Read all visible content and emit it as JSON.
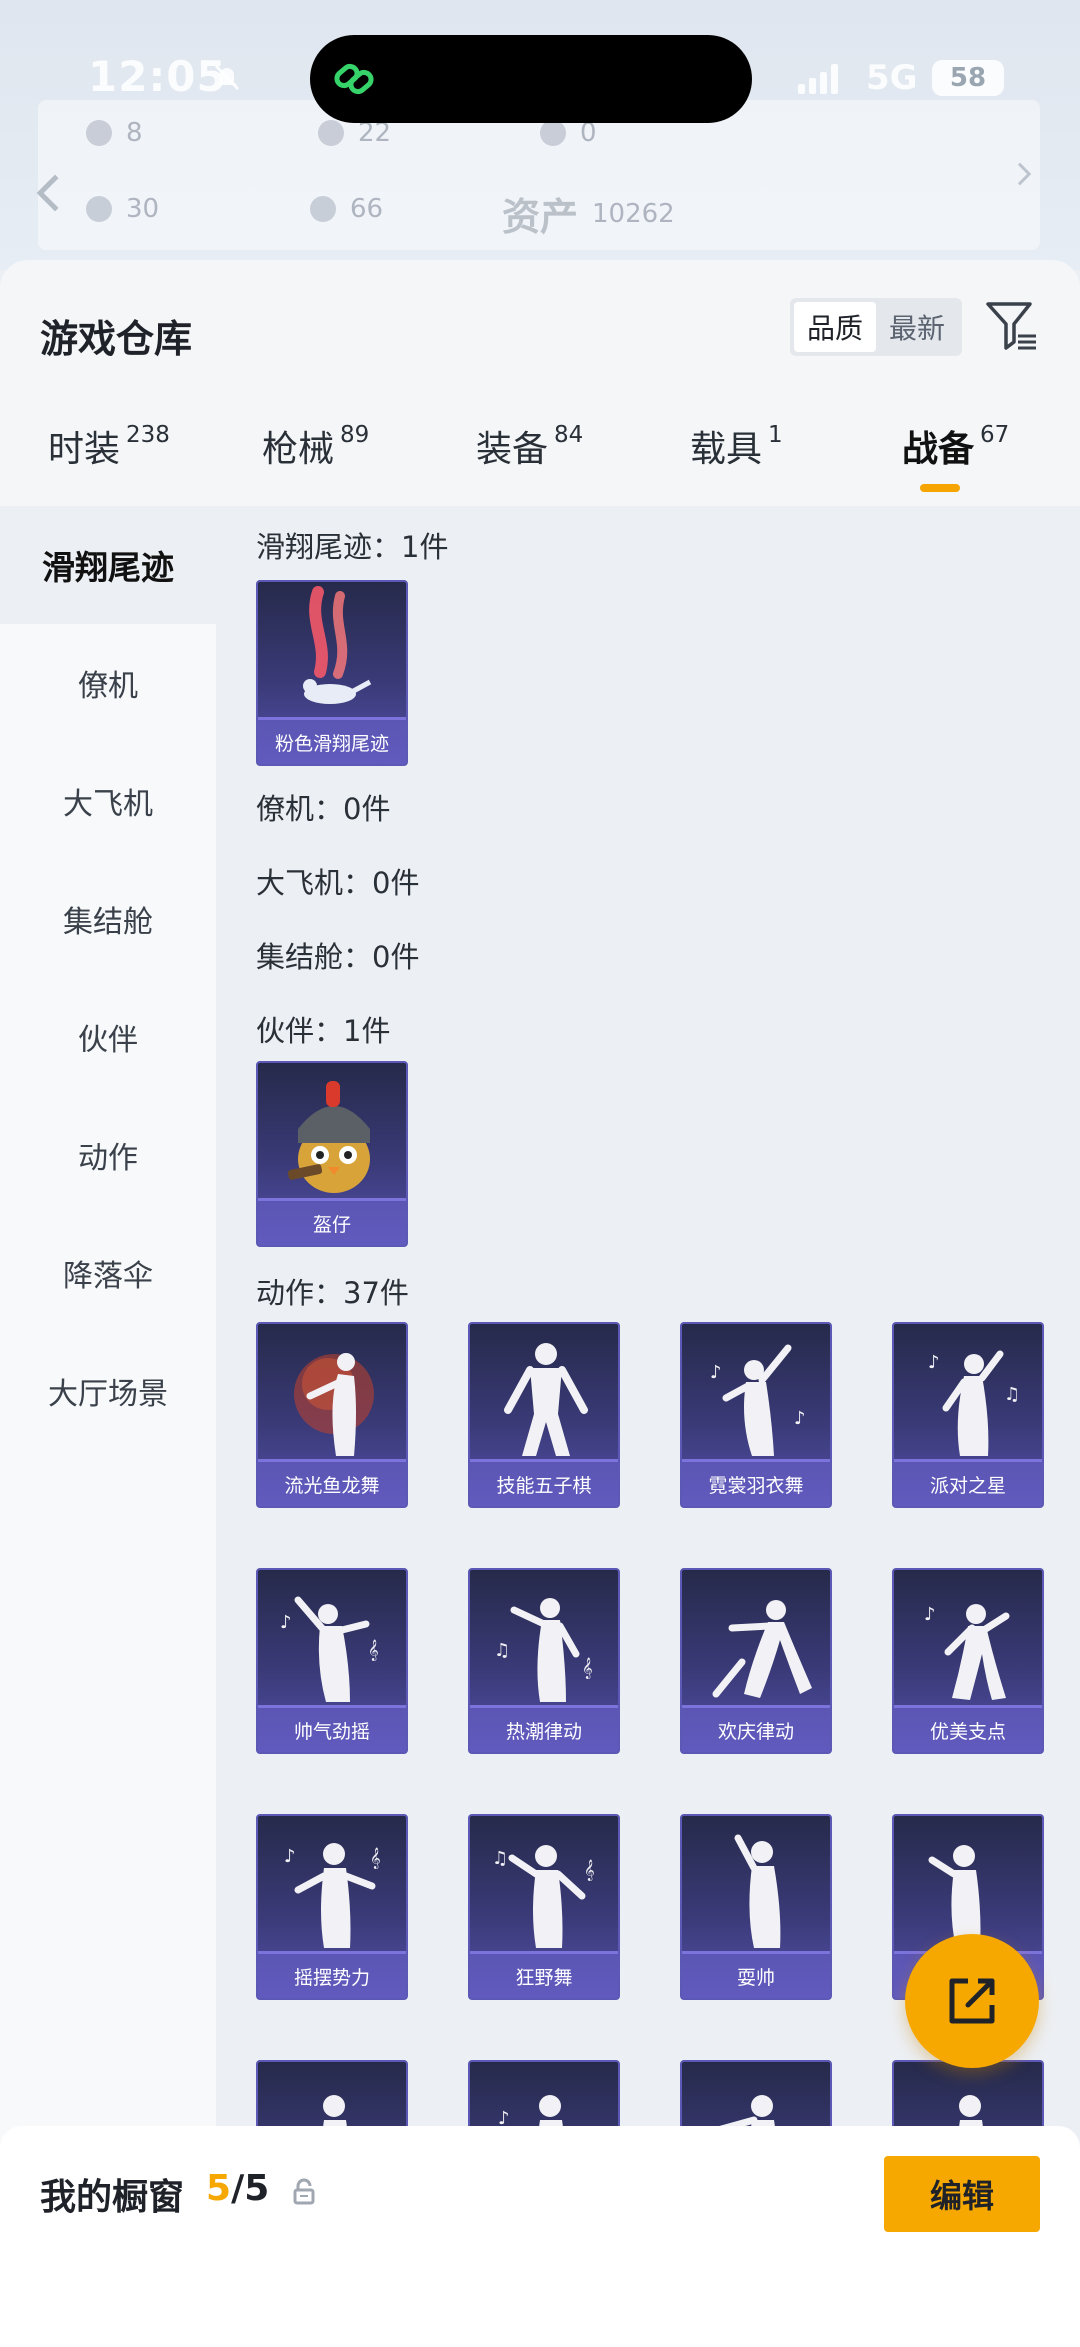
{
  "status_bar": {
    "time": "12:05",
    "network": "5G",
    "battery": "58"
  },
  "background": {
    "stats": [
      "8",
      "22",
      "0",
      "30",
      "66"
    ],
    "asset_label": "资产",
    "asset_value": "10262"
  },
  "sheet": {
    "title": "游戏仓库",
    "sort_options": [
      {
        "label": "品质",
        "active": true
      },
      {
        "label": "最新",
        "active": false
      }
    ]
  },
  "tabs": [
    {
      "label": "时装",
      "count": "238",
      "active": false
    },
    {
      "label": "枪械",
      "count": "89",
      "active": false
    },
    {
      "label": "装备",
      "count": "84",
      "active": false
    },
    {
      "label": "载具",
      "count": "1",
      "active": false
    },
    {
      "label": "战备",
      "count": "67",
      "active": true
    }
  ],
  "sidenav": [
    {
      "label": "滑翔尾迹",
      "active": true
    },
    {
      "label": "僚机",
      "active": false
    },
    {
      "label": "大飞机",
      "active": false
    },
    {
      "label": "集结舱",
      "active": false
    },
    {
      "label": "伙伴",
      "active": false
    },
    {
      "label": "动作",
      "active": false
    },
    {
      "label": "降落伞",
      "active": false
    },
    {
      "label": "大厅场景",
      "active": false
    }
  ],
  "sections": {
    "glide": "滑翔尾迹：1件",
    "wingman": "僚机：0件",
    "plane": "大飞机：0件",
    "pod": "集结舱：0件",
    "partner": "伙伴：1件",
    "emote": "动作：37件"
  },
  "items": {
    "glide": [
      "粉色滑翔尾迹"
    ],
    "partner": [
      "盔仔"
    ],
    "emote": [
      "流光鱼龙舞",
      "技能五子棋",
      "霓裳羽衣舞",
      "派对之星",
      "帅气劲摇",
      "热潮律动",
      "欢庆律动",
      "优美支点",
      "摇摆势力",
      "狂野舞",
      "耍帅",
      "",
      "",
      "",
      "",
      ""
    ]
  },
  "showcase": {
    "label": "我的橱窗",
    "current": "5",
    "total": "/5",
    "edit_label": "编辑"
  },
  "colors": {
    "accent": "#f6a800",
    "card_bg": "#3a3a78",
    "card_border": "#5c58b5"
  }
}
